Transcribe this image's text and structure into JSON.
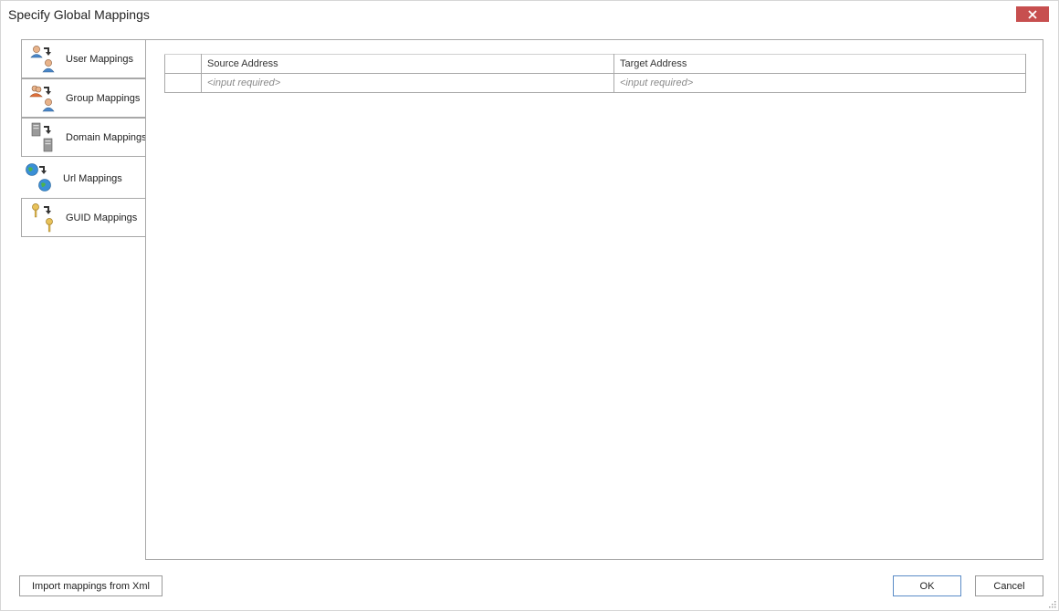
{
  "window": {
    "title": "Specify Global Mappings"
  },
  "sidebar": {
    "items": [
      {
        "label": "User Mappings",
        "icon": "user-mapping-icon",
        "active": false
      },
      {
        "label": "Group Mappings",
        "icon": "group-mapping-icon",
        "active": false
      },
      {
        "label": "Domain Mappings",
        "icon": "domain-mapping-icon",
        "active": false
      },
      {
        "label": "Url Mappings",
        "icon": "url-mapping-icon",
        "active": true
      },
      {
        "label": "GUID Mappings",
        "icon": "guid-mapping-icon",
        "active": false
      }
    ]
  },
  "grid": {
    "columns": [
      "Source Address",
      "Target Address"
    ],
    "rows": [
      {
        "source": "<input required>",
        "target": "<input required>"
      }
    ]
  },
  "footer": {
    "import_label": "Import mappings from Xml",
    "ok_label": "OK",
    "cancel_label": "Cancel"
  },
  "colors": {
    "close_button": "#c74f4f",
    "primary_border": "#5b8cc7",
    "border": "#a8a8a8"
  }
}
